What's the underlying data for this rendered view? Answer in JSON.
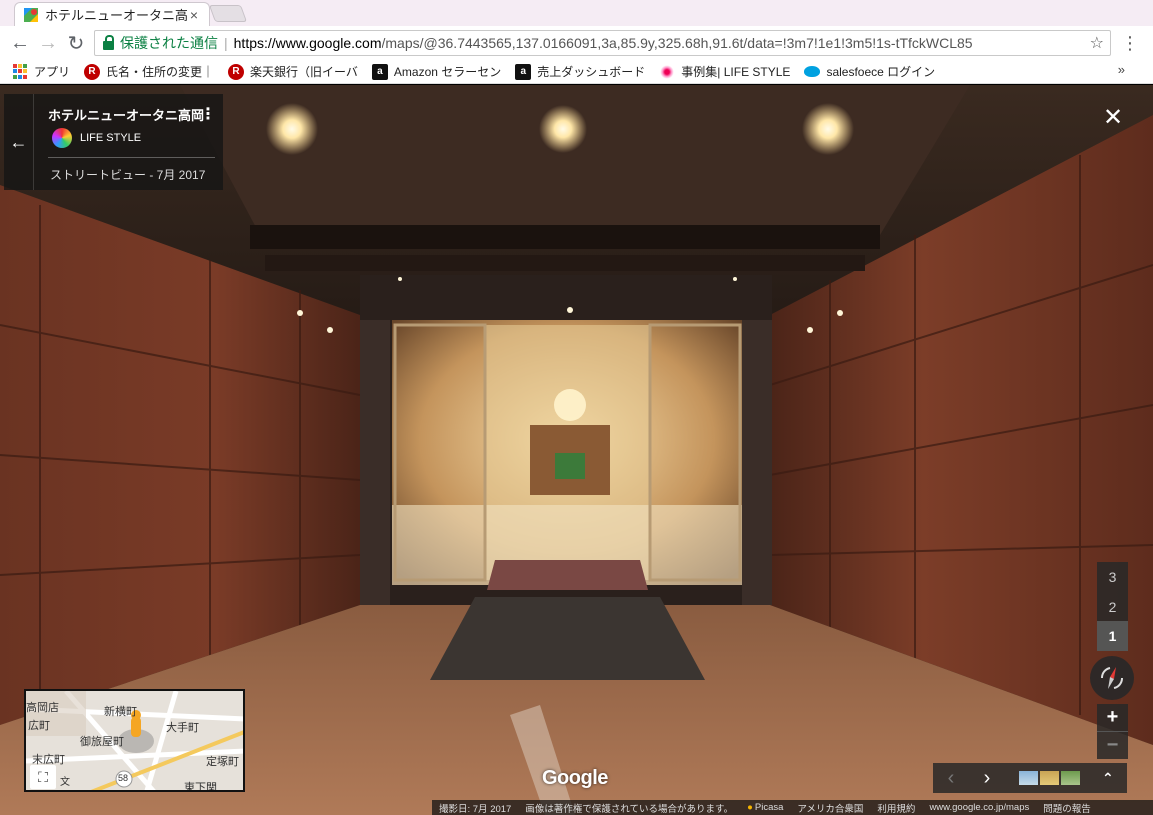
{
  "browser": {
    "tab_title": "ホテルニューオータニ高",
    "tab_close": "×",
    "omnibox": {
      "secure_label": "保護された通信",
      "url_host": "https://www.google.com",
      "url_path": "/maps/@36.7443565,137.0166091,3a,85.9y,325.68h,91.6t/data=!3m7!1e1!3m5!1s-tTfckWCL85"
    },
    "bookmarks": [
      {
        "label": "アプリ",
        "icon": "apps-grid-icon"
      },
      {
        "label": "氏名・住所の変更｜",
        "icon": "rakuten-icon"
      },
      {
        "label": "楽天銀行（旧イーバ",
        "icon": "rakuten-icon"
      },
      {
        "label": "Amazon セラーセン",
        "icon": "amazon-icon"
      },
      {
        "label": "売上ダッシュボード",
        "icon": "amazon-icon"
      },
      {
        "label": "事例集| LIFE STYLE",
        "icon": "lifestyle-icon"
      },
      {
        "label": "salesfoece ログイン",
        "icon": "salesforce-icon"
      }
    ],
    "bookmarks_more": "»"
  },
  "streetview": {
    "place_name": "ホテルニューオータニ高岡",
    "author": "LIFE STYLE",
    "capture": "ストリートビュー - 7月 2017",
    "floors": [
      "3",
      "2",
      "1"
    ],
    "active_floor": "1",
    "zoom_in": "+",
    "zoom_out": "−",
    "logo": "Google",
    "minimap_labels": [
      {
        "text": "高岡店"
      },
      {
        "text": "広町"
      },
      {
        "text": "新横町"
      },
      {
        "text": "大手町"
      },
      {
        "text": "御旅屋町"
      },
      {
        "text": "末広町"
      },
      {
        "text": "定塚町"
      },
      {
        "text": "東下関"
      },
      {
        "text": "58"
      },
      {
        "text": "文"
      }
    ],
    "footer": {
      "capture_date": "撮影日: 7月 2017",
      "copyright": "画像は著作権で保護されている場合があります。",
      "picasa": "Picasa",
      "region": "アメリカ合衆国",
      "terms": "利用規約",
      "domain": "www.google.co.jp/maps",
      "report": "問題の報告"
    }
  }
}
